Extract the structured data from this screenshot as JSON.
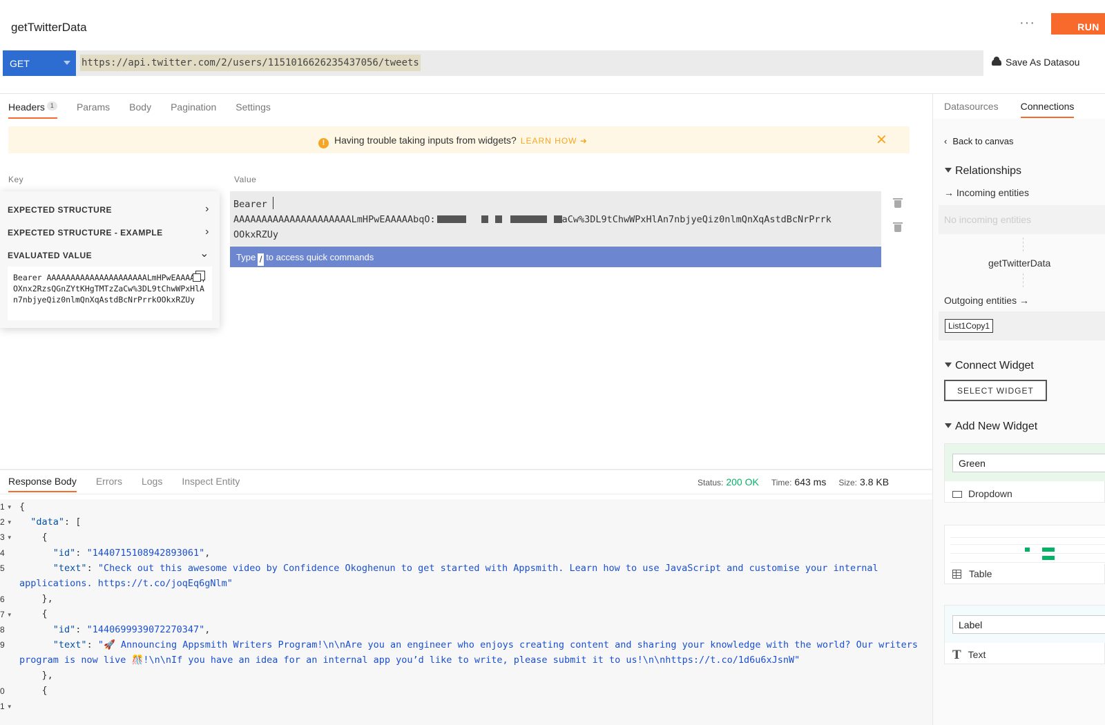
{
  "header": {
    "api_name": "getTwitterData",
    "more_label": "···",
    "run_label": "RUN",
    "method": "GET",
    "url": "https://api.twitter.com/2/users/1151016626235437056/tweets",
    "save_as_datasource": "Save As Datasou"
  },
  "tabs": [
    {
      "label": "Headers",
      "badge": "1"
    },
    {
      "label": "Params"
    },
    {
      "label": "Body"
    },
    {
      "label": "Pagination"
    },
    {
      "label": "Settings"
    }
  ],
  "banner": {
    "message": "Having trouble taking inputs from widgets?",
    "link": "LEARN HOW ➜",
    "close": "✕"
  },
  "headers_table": {
    "key_label": "Key",
    "value_label": "Value",
    "value_line1": "Bearer",
    "value_line2_start": "AAAAAAAAAAAAAAAAAAAAALmHPwEAAAAAbqO:",
    "value_line2_end": "aCw%3DL9tChwWPxHlAn7nbjyeQiz0nlmQnXqAstdBcNrPrrk",
    "value_line3": "OOkxRZUy",
    "hint_pre": "Type",
    "hint_key": "/",
    "hint_post": "to access quick commands"
  },
  "eval_popup": {
    "expected_structure": "EXPECTED STRUCTURE",
    "expected_structure_example": "EXPECTED STRUCTURE - EXAMPLE",
    "evaluated_value": "EVALUATED VALUE",
    "evaluated_text": "Bearer AAAAAAAAAAAAAAAAAAAAALmHPwEAAAAbqOXnx2RzsQGnZYtKHgTMTzZaCw%3DL9tChwWPxHlAn7nbjyeQiz0nlmQnXqAstdBcNrPrrkOOkxRZUy"
  },
  "response": {
    "tabs": [
      "Response Body",
      "Errors",
      "Logs",
      "Inspect Entity"
    ],
    "status_label": "Status:",
    "status_value": "200 OK",
    "time_label": "Time:",
    "time_value": "643 ms",
    "size_label": "Size:",
    "size_value": "3.8 KB",
    "line_numbers": [
      "1",
      "2",
      "3",
      "4",
      "5",
      "6",
      "7",
      "8",
      "9",
      "0",
      "1"
    ],
    "code": {
      "l1": "{",
      "l2_key": "\"data\"",
      "l2_rest": ": [",
      "l3": "{",
      "id_key": "\"id\"",
      "id1": "\"1440715108942893061\"",
      "text_key": "\"text\"",
      "text1": "\"Check out this awesome video by Confidence Okoghenun to get started with Appsmith. Learn how to use JavaScript and customise your internal applications. https://t.co/joqEq6gNlm\"",
      "close_obj": "},",
      "open_obj": "{",
      "id2": "\"1440699939072270347\"",
      "text2": "\"🚀 Announcing Appsmith Writers Program!\\n\\nAre you an engineer who enjoys creating content and sharing your knowledge with the world? Our writers program is now live 🎊!\\n\\nIf you have an idea for an internal app you’d like to write, please submit it to us!\\n\\nhttps://t.co/1d6u6xJsnW\""
    }
  },
  "right_panel": {
    "tabs": [
      "Datasources",
      "Connections"
    ],
    "back": "Back to canvas",
    "relationships": "Relationships",
    "incoming": "→ Incoming entities",
    "no_incoming": "No incoming entities",
    "current_entity": "getTwitterData",
    "outgoing": "Outgoing entities →",
    "outgoing_chip": "List1Copy1",
    "connect_widget": "Connect Widget",
    "select_widget": "SELECT WIDGET",
    "add_new_widget": "Add New Widget",
    "widgets": [
      {
        "preview": "Green",
        "name": "Dropdown"
      },
      {
        "name": "Table"
      },
      {
        "preview": "Label",
        "name": "Text"
      }
    ]
  }
}
